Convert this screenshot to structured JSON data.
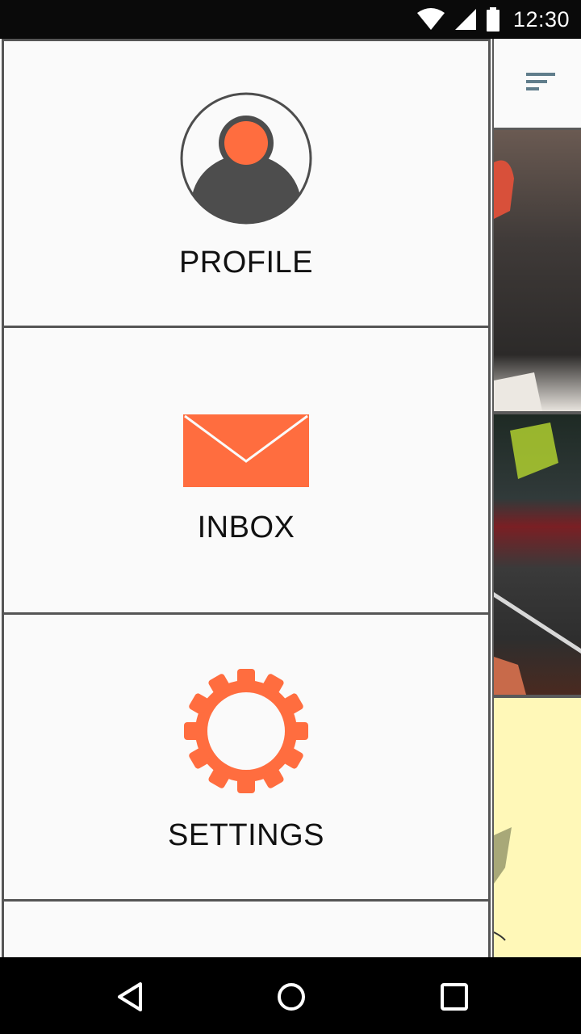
{
  "status_bar": {
    "time": "12:30",
    "icons": [
      "wifi-icon",
      "cell-signal-icon",
      "battery-icon"
    ]
  },
  "drawer": {
    "items": [
      {
        "label": "PROFILE",
        "icon": "profile-icon"
      },
      {
        "label": "INBOX",
        "icon": "mail-icon"
      },
      {
        "label": "SETTINGS",
        "icon": "gear-icon"
      }
    ]
  },
  "toolbar": {
    "icon": "sort-icon"
  },
  "nav_bar": {
    "icons": [
      "back-icon",
      "home-icon",
      "recent-apps-icon"
    ]
  },
  "colors": {
    "accent": "#ff6d3f",
    "icon_dark": "#4d4d4d",
    "border": "#555555",
    "drawer_bg": "#fafafa",
    "status_bg": "#0a0a0a"
  }
}
